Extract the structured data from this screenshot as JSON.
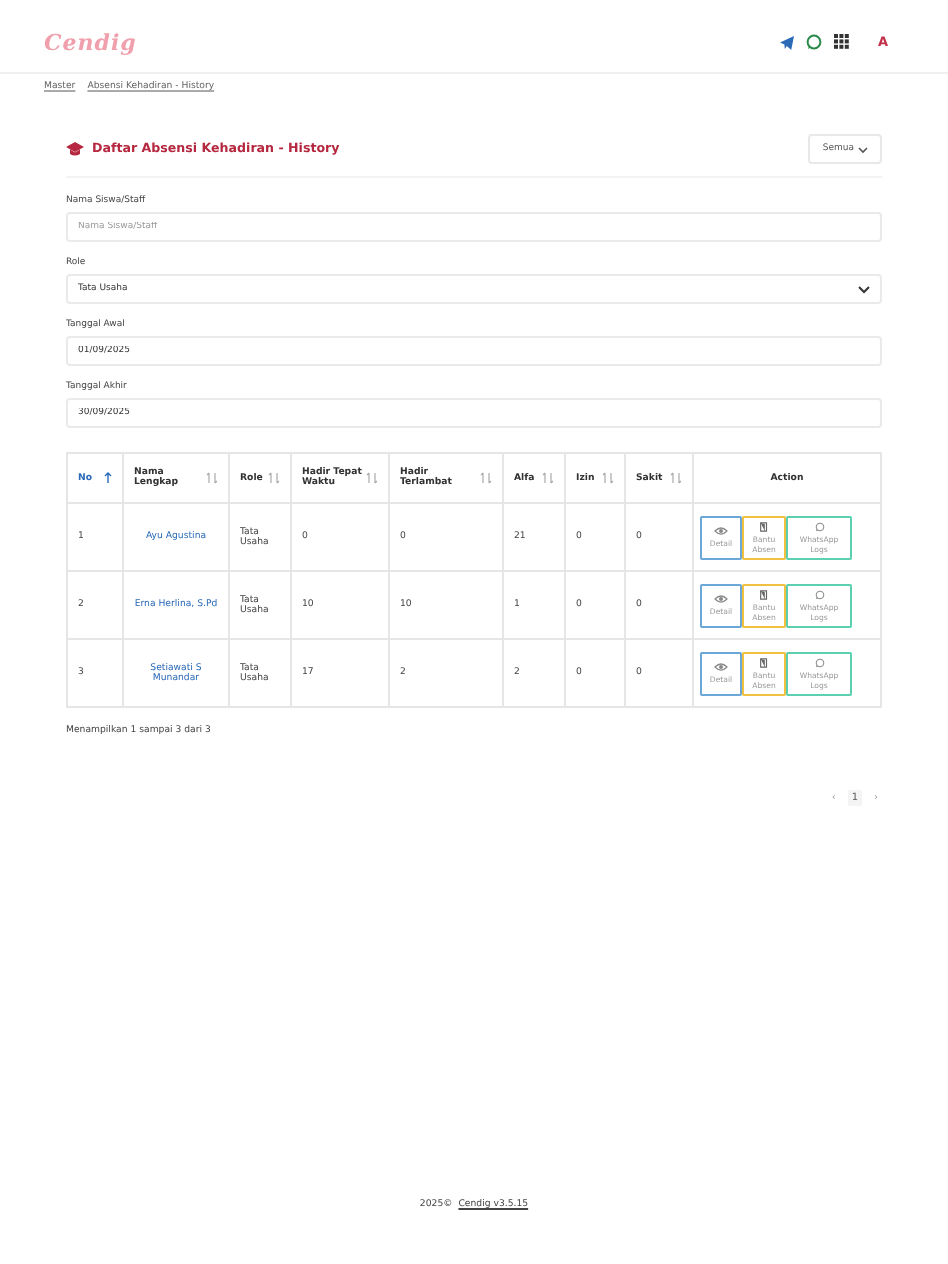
{
  "header": {
    "logo": "Cendig",
    "user_initial": "A"
  },
  "breadcrumb": [
    "Master",
    "Absensi Kehadiran - History"
  ],
  "card": {
    "title": "Daftar Absensi Kehadiran - History",
    "filter_button": "Semua"
  },
  "form": [
    {
      "kind": "text",
      "label": "Nama Siswa/Staff",
      "placeholder": "Nama Siswa/Staff"
    },
    {
      "kind": "select",
      "label": "Role",
      "value": "Tata Usaha"
    },
    {
      "kind": "text",
      "label": "Tanggal Awal",
      "value": "01/09/2025"
    },
    {
      "kind": "text",
      "label": "Tanggal Akhir",
      "value": "30/09/2025"
    }
  ],
  "table": {
    "columns": [
      {
        "label": "No",
        "sorted": true
      },
      {
        "label": "Nama Lengkap",
        "sorted": false
      },
      {
        "label": "Role",
        "sorted": false
      },
      {
        "label": "Hadir Tepat Waktu",
        "sorted": false
      },
      {
        "label": "Hadir Terlambat",
        "sorted": false
      },
      {
        "label": "Alfa",
        "sorted": false
      },
      {
        "label": "Izin",
        "sorted": false
      },
      {
        "label": "Sakit",
        "sorted": false
      },
      {
        "label": "Action"
      }
    ],
    "rows": [
      {
        "cells": [
          "1",
          "Ayu Agustina",
          "Tata Usaha",
          "0",
          "0",
          "21",
          "0",
          "0"
        ],
        "actions": [
          {
            "kind": "detail",
            "label": "Detail"
          },
          {
            "kind": "assist",
            "label": "Bantu Absen"
          },
          {
            "kind": "whatsapp",
            "label": "WhatsApp Logs"
          }
        ]
      },
      {
        "cells": [
          "2",
          "Erna Herlina, S.Pd",
          "Tata Usaha",
          "10",
          "10",
          "1",
          "0",
          "0"
        ],
        "actions": [
          {
            "kind": "detail",
            "label": "Detail"
          },
          {
            "kind": "assist",
            "label": "Bantu Absen"
          },
          {
            "kind": "whatsapp",
            "label": "WhatsApp Logs"
          }
        ]
      },
      {
        "cells": [
          "3",
          "Setiawati S Munandar",
          "Tata Usaha",
          "17",
          "2",
          "2",
          "0",
          "0"
        ],
        "actions": [
          {
            "kind": "detail",
            "label": "Detail"
          },
          {
            "kind": "assist",
            "label": "Bantu Absen"
          },
          {
            "kind": "whatsapp",
            "label": "WhatsApp Logs"
          }
        ]
      }
    ]
  },
  "table_info": "Menampilkan 1 sampai 3 dari 3",
  "pagination": {
    "prev": "‹",
    "pages": [
      {
        "label": "1",
        "selected": true
      }
    ],
    "next": "›"
  },
  "footer": {
    "copyright": "2025©",
    "version_link": "Cendig v3.5.15"
  }
}
